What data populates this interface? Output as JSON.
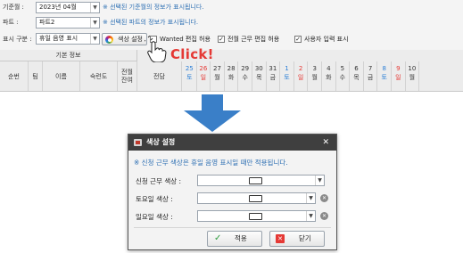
{
  "top": {
    "month_label": "기준월 :",
    "month_value": "2023년 04월",
    "month_hint": "※ 선택된 기준월의 정보가 표시됩니다.",
    "part_label": "파트 :",
    "part_value": "파트2",
    "part_hint": "※ 선택된 파트의 정보가 표시됩니다.",
    "display_label": "표시 구분 :",
    "display_value": "휴일 음영 표시",
    "color_button": "색상 설정",
    "checks": [
      {
        "label": "Wanted 편집 허용",
        "checked": false
      },
      {
        "label": "전월 근무 편집 허용",
        "checked": true
      },
      {
        "label": "사용자 입력 표시",
        "checked": true
      }
    ]
  },
  "grid": {
    "group_header": "기본 정보",
    "columns": [
      "순번",
      "팀",
      "이름",
      "숙련도",
      "전월 잔여",
      "전담"
    ],
    "days": [
      {
        "n": "25",
        "w": "토",
        "t": "sat"
      },
      {
        "n": "26",
        "w": "일",
        "t": "sun"
      },
      {
        "n": "27",
        "w": "월",
        "t": "wk"
      },
      {
        "n": "28",
        "w": "화",
        "t": "wk"
      },
      {
        "n": "29",
        "w": "수",
        "t": "wk"
      },
      {
        "n": "30",
        "w": "목",
        "t": "wk"
      },
      {
        "n": "31",
        "w": "금",
        "t": "wk"
      },
      {
        "n": "1",
        "w": "토",
        "t": "sat"
      },
      {
        "n": "2",
        "w": "일",
        "t": "sun"
      },
      {
        "n": "3",
        "w": "월",
        "t": "wk"
      },
      {
        "n": "4",
        "w": "화",
        "t": "wk"
      },
      {
        "n": "5",
        "w": "수",
        "t": "wk"
      },
      {
        "n": "6",
        "w": "목",
        "t": "wk"
      },
      {
        "n": "7",
        "w": "금",
        "t": "wk"
      },
      {
        "n": "8",
        "w": "토",
        "t": "sat"
      },
      {
        "n": "9",
        "w": "일",
        "t": "sun"
      },
      {
        "n": "10",
        "w": "월",
        "t": "wk"
      }
    ]
  },
  "click_text": "Click!",
  "dialog": {
    "title": "색상 설정",
    "close": "✕",
    "note": "※ 신청 근무 색상은 휴일 음영 표시일 때만 적용됩니다.",
    "fields": [
      {
        "label": "신청 근무 색상 :",
        "has_clear": false
      },
      {
        "label": "토요일 색상 :",
        "has_clear": true
      },
      {
        "label": "일요일 색상 :",
        "has_clear": true
      }
    ],
    "apply": "적용",
    "close_button": "닫기"
  },
  "colors": {
    "saturday": "#2c7fd6",
    "sunday": "#e53935",
    "hint": "#2d6fb3",
    "click": "#e53935",
    "arrow": "#3a7fc8"
  },
  "icons": [
    "color-wheel-icon",
    "hand-cursor-icon",
    "down-arrow-icon",
    "dialog-icon",
    "check-icon",
    "cancel-icon",
    "clear-icon",
    "dropdown-icon"
  ]
}
